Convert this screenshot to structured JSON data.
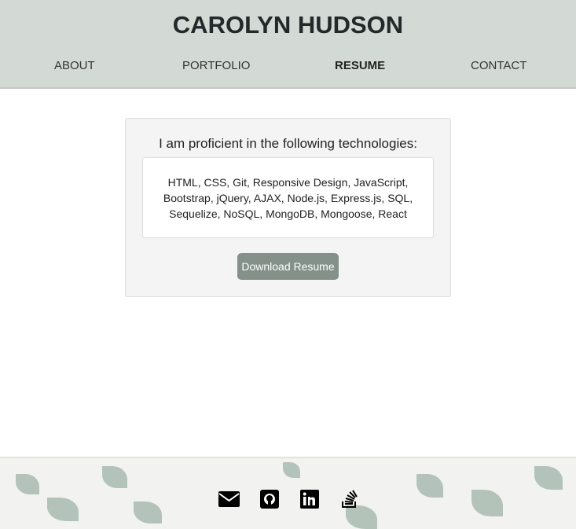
{
  "header": {
    "title": "CAROLYN HUDSON",
    "nav": [
      "ABOUT",
      "PORTFOLIO",
      "RESUME",
      "CONTACT"
    ],
    "active": "RESUME"
  },
  "main": {
    "heading": "I am proficient in the following technologies:",
    "skills": "HTML, CSS, Git, Responsive Design, JavaScript, Bootstrap, jQuery, AJAX, Node.js, Express.js, SQL, Sequelize, NoSQL, MongoDB, Mongoose, React",
    "download_label": "Download Resume"
  },
  "footer": {
    "icons": [
      "email-icon",
      "github-icon",
      "linkedin-icon",
      "stackoverflow-icon"
    ]
  },
  "colors": {
    "header_bg": "#d3d9d4",
    "button": "#849189"
  }
}
